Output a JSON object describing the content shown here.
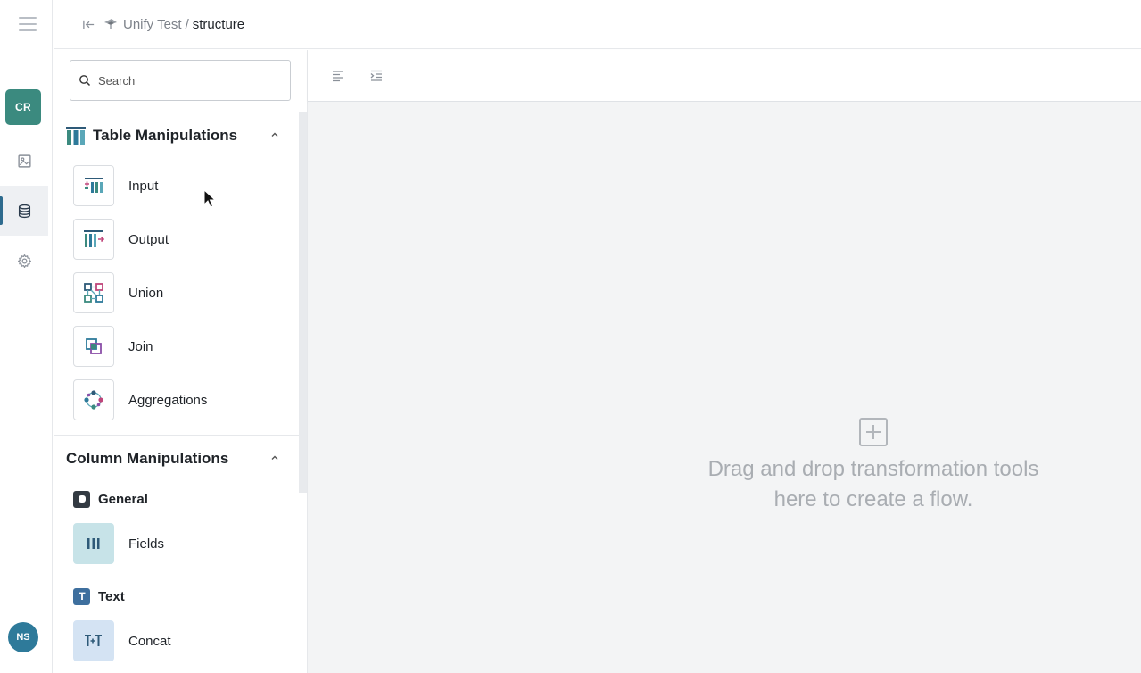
{
  "rail": {
    "menu_icon": "hamburger-icon",
    "org_badge": "CR",
    "items": [
      {
        "name": "image-icon",
        "active": false
      },
      {
        "name": "database-icon",
        "active": true
      },
      {
        "name": "gear-icon",
        "active": false
      }
    ],
    "user_initials": "NS"
  },
  "breadcrumb": {
    "project": "Unify Test",
    "separator": "/",
    "current": "structure"
  },
  "search": {
    "placeholder": "Search",
    "value": ""
  },
  "palette": {
    "table_section": {
      "title": "Table Manipulations",
      "tools": [
        {
          "label": "Input",
          "icon": "input-icon"
        },
        {
          "label": "Output",
          "icon": "output-icon"
        },
        {
          "label": "Union",
          "icon": "union-icon"
        },
        {
          "label": "Join",
          "icon": "join-icon"
        },
        {
          "label": "Aggregations",
          "icon": "aggregations-icon"
        }
      ]
    },
    "column_section": {
      "title": "Column Manipulations",
      "groups": [
        {
          "label": "General",
          "icon": "general-icon",
          "tools": [
            {
              "label": "Fields",
              "icon": "fields-icon"
            }
          ]
        },
        {
          "label": "Text",
          "icon": "text-icon",
          "tools": [
            {
              "label": "Concat",
              "icon": "concat-icon"
            }
          ]
        }
      ]
    }
  },
  "toolbar": {
    "buttons": [
      "align-left-icon",
      "indent-icon"
    ]
  },
  "canvas": {
    "empty_line1": "Drag and drop transformation tools",
    "empty_line2": "here to create a flow."
  },
  "colors": {
    "accent": "#3b8a7f",
    "avatar": "#2e7a9a",
    "canvas_bg": "#f3f4f5",
    "empty_text": "#a9adb2"
  }
}
